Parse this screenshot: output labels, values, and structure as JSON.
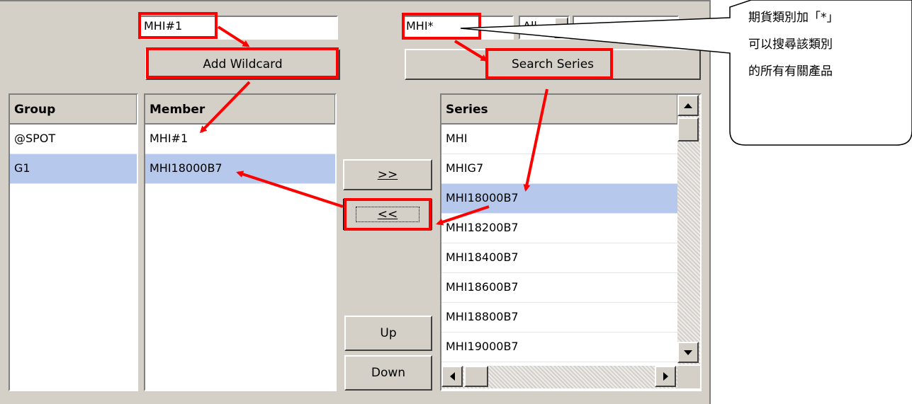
{
  "top": {
    "member_input": "MHI#1",
    "series_input": "MHI*",
    "series_type_select": "All",
    "add_wildcard": "Add Wildcard",
    "search_series": "Search Series"
  },
  "group_list": {
    "header": "Group",
    "items": [
      "@SPOT",
      "G1"
    ],
    "selected_index": 1
  },
  "member_list": {
    "header": "Member",
    "items": [
      "MHI#1",
      "MHI18000B7"
    ],
    "selected_index": 1
  },
  "middle_buttons": {
    "add": ">>",
    "remove": "<<",
    "up": "Up",
    "down": "Down"
  },
  "series_list": {
    "header": "Series",
    "items": [
      "MHI",
      "MHIG7",
      "MHI18000B7",
      "MHI18200B7",
      "MHI18400B7",
      "MHI18600B7",
      "MHI18800B7",
      "MHI19000B7"
    ],
    "selected_index": 2
  },
  "callout": {
    "lines": [
      "期貨類別加「*」",
      "可以搜尋該類別",
      "的所有有關產品"
    ]
  },
  "colors": {
    "annotation": "#ff0000",
    "selection": "#b6c8ec",
    "window": "#d4d0c8"
  }
}
